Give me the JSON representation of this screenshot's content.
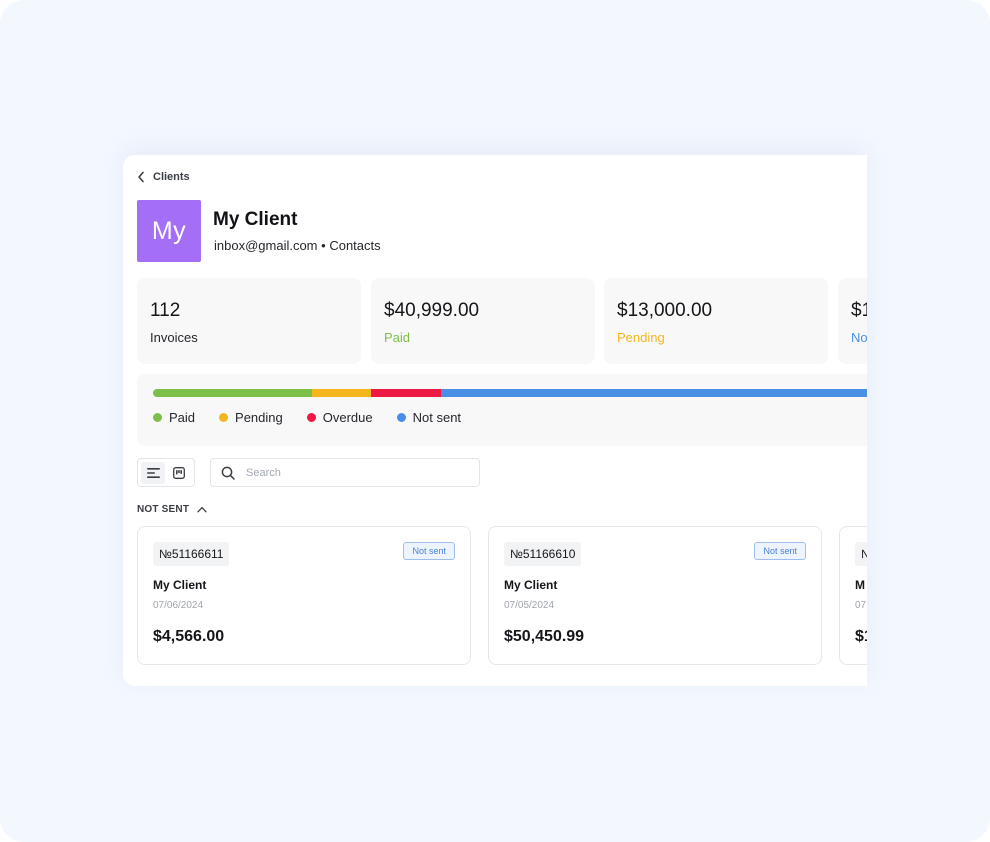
{
  "breadcrumb": {
    "label": "Clients",
    "icon": "chevron-left-icon"
  },
  "client": {
    "initials": "My",
    "name": "My Client",
    "email": "inbox@gmail.com",
    "separator": "•",
    "contacts_link": "Contacts",
    "avatar_color": "#a46ff4"
  },
  "stats": [
    {
      "value": "112",
      "label": "Invoices",
      "label_color": "#25272d"
    },
    {
      "value": "$40,999.00",
      "label": "Paid",
      "label_color": "#7cc04a"
    },
    {
      "value": "$13,000.00",
      "label": "Pending",
      "label_color": "#f5b51c"
    },
    {
      "value": "$1",
      "label": "No",
      "label_color": "#4a8fe6"
    }
  ],
  "status_bar": {
    "segments": [
      {
        "name": "Paid",
        "color": "#7cc04a",
        "share": 0.22
      },
      {
        "name": "Pending",
        "color": "#f5b51c",
        "share": 0.082
      },
      {
        "name": "Overdue",
        "color": "#ee1844",
        "share": 0.096
      },
      {
        "name": "Not sent",
        "color": "#4a8fe6",
        "share": 0.602
      }
    ]
  },
  "toolbar": {
    "list_view_icon": "list-view-icon",
    "board_view_icon": "board-view-icon",
    "search_placeholder": "Search"
  },
  "group": {
    "title": "NOT SENT",
    "icon": "chevron-up-icon"
  },
  "invoices": [
    {
      "number": "№51166611",
      "status": "Not sent",
      "client": "My Client",
      "date": "07/06/2024",
      "amount": "$4,566.00"
    },
    {
      "number": "№51166610",
      "status": "Not sent",
      "client": "My Client",
      "date": "07/05/2024",
      "amount": "$50,450.99"
    },
    {
      "number": "№",
      "status": "",
      "client": "M",
      "date": "07",
      "amount": "$1"
    }
  ]
}
